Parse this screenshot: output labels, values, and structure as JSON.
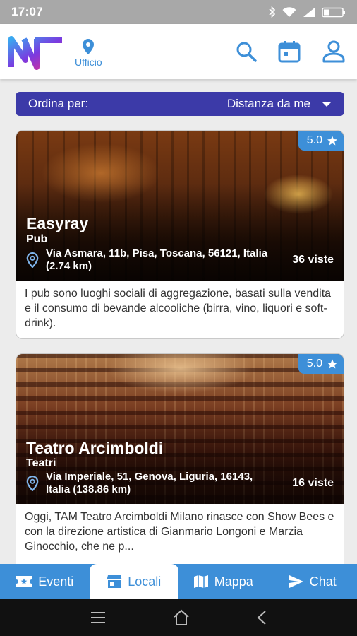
{
  "status_bar": {
    "time": "17:07"
  },
  "header": {
    "location_label": "Ufficio"
  },
  "sort": {
    "label": "Ordina per:",
    "value": "Distanza da me"
  },
  "cards": [
    {
      "rating": "5.0",
      "title": "Easyray",
      "category": "Pub",
      "address": "Via Asmara, 11b, Pisa, Toscana, 56121, Italia (2.74 km)",
      "views": "36 viste",
      "description": "I pub sono luoghi sociali di aggregazione, basati sulla vendita e il consumo di bevande alcooliche (birra, vino, liquori e soft-drink)."
    },
    {
      "rating": "5.0",
      "title": "Teatro Arcimboldi",
      "category": "Teatri",
      "address": "Via Imperiale, 51, Genova, Liguria, 16143, Italia (138.86 km)",
      "views": "16 viste",
      "description": "Oggi, TAM Teatro Arcimboldi Milano rinasce con Show Bees e con la direzione artistica di Gianmario Longoni e Marzia Ginocchio, che ne p..."
    }
  ],
  "bottom_nav": [
    {
      "label": "Eventi",
      "icon": "ticket-icon",
      "active": false
    },
    {
      "label": "Locali",
      "icon": "store-icon",
      "active": true
    },
    {
      "label": "Mappa",
      "icon": "map-icon",
      "active": false
    },
    {
      "label": "Chat",
      "icon": "send-icon",
      "active": false
    }
  ],
  "colors": {
    "primary": "#3d8fd8",
    "sort_bar": "#3c3aa8",
    "active_nav_bg": "#ffffff"
  }
}
